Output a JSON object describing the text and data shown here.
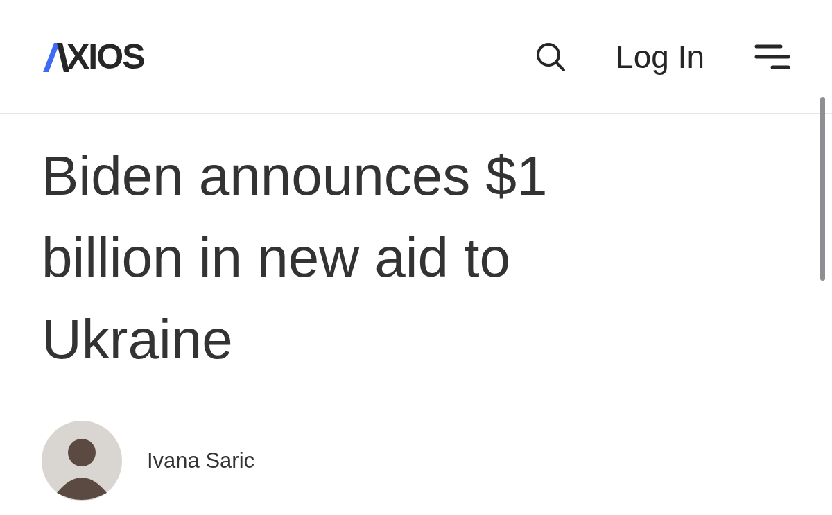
{
  "header": {
    "logo_text": "XIOS",
    "login": "Log In"
  },
  "article": {
    "headline": "Biden announces $1 billion in new aid to Ukraine",
    "author": "Ivana Saric"
  }
}
